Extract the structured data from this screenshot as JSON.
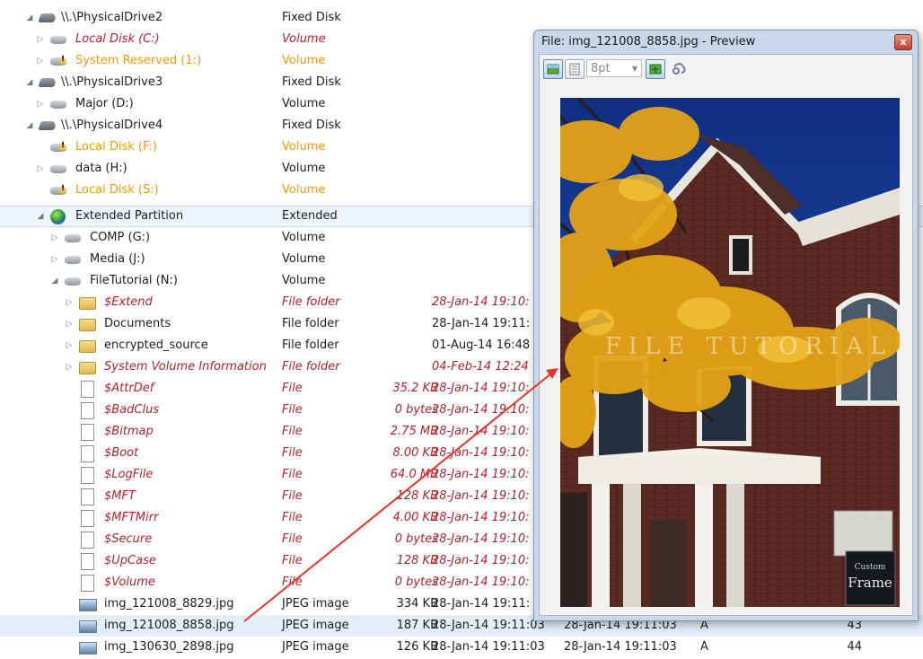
{
  "rows": [
    {
      "name": "\\\\.\\PhysicalDrive2",
      "type": "Fixed Disk"
    },
    {
      "name": "Local Disk (C:)",
      "type": "Volume"
    },
    {
      "name": "System Reserved (1:)",
      "type": "Volume"
    },
    {
      "name": "\\\\.\\PhysicalDrive3",
      "type": "Fixed Disk"
    },
    {
      "name": "Major (D:)",
      "type": "Volume"
    },
    {
      "name": "\\\\.\\PhysicalDrive4",
      "type": "Fixed Disk"
    },
    {
      "name": "Local Disk (F:)",
      "type": "Volume"
    },
    {
      "name": "data (H:)",
      "type": "Volume"
    },
    {
      "name": "Local Disk (S:)",
      "type": "Volume"
    },
    {
      "name": "Extended Partition",
      "type": "Extended"
    },
    {
      "name": "COMP (G:)",
      "type": "Volume"
    },
    {
      "name": "Media (J:)",
      "type": "Volume"
    },
    {
      "name": "FileTutorial (N:)",
      "type": "Volume"
    },
    {
      "name": "$Extend",
      "type": "File folder",
      "created": "28-Jan-14 19:10:"
    },
    {
      "name": "Documents",
      "type": "File folder",
      "created": "28-Jan-14 19:11:"
    },
    {
      "name": "encrypted_source",
      "type": "File folder",
      "created": "01-Aug-14 16:48"
    },
    {
      "name": "System Volume Information",
      "type": "File folder",
      "created": "04-Feb-14 12:24"
    },
    {
      "name": "$AttrDef",
      "type": "File",
      "size": "35.2 KB",
      "created": "28-Jan-14 19:10:"
    },
    {
      "name": "$BadClus",
      "type": "File",
      "size": "0 bytes",
      "created": "28-Jan-14 19:10:"
    },
    {
      "name": "$Bitmap",
      "type": "File",
      "size": "2.75 MB",
      "created": "28-Jan-14 19:10:"
    },
    {
      "name": "$Boot",
      "type": "File",
      "size": "8.00 KB",
      "created": "28-Jan-14 19:10:"
    },
    {
      "name": "$LogFile",
      "type": "File",
      "size": "64.0 MB",
      "created": "28-Jan-14 19:10:"
    },
    {
      "name": "$MFT",
      "type": "File",
      "size": "128 KB",
      "created": "28-Jan-14 19:10:"
    },
    {
      "name": "$MFTMirr",
      "type": "File",
      "size": "4.00 KB",
      "created": "28-Jan-14 19:10:"
    },
    {
      "name": "$Secure",
      "type": "File",
      "size": "0 bytes",
      "created": "28-Jan-14 19:10:"
    },
    {
      "name": "$UpCase",
      "type": "File",
      "size": "128 KB",
      "created": "28-Jan-14 19:10:"
    },
    {
      "name": "$Volume",
      "type": "File",
      "size": "0 bytes",
      "created": "28-Jan-14 19:10:"
    },
    {
      "name": "img_121008_8829.jpg",
      "type": "JPEG image",
      "size": "334 KB",
      "created": "28-Jan-14 19:11:"
    },
    {
      "name": "img_121008_8858.jpg",
      "type": "JPEG image",
      "size": "187 KB",
      "created": "28-Jan-14 19:11:03",
      "modified": "28-Jan-14 19:11:03",
      "attr": "A",
      "num": "43"
    },
    {
      "name": "img_130630_2898.jpg",
      "type": "JPEG image",
      "size": "126 KB",
      "created": "28-Jan-14 19:11:03",
      "modified": "28-Jan-14 19:11:03",
      "attr": "A",
      "num": "44"
    }
  ],
  "preview": {
    "title": "File: img_121008_8858.jpg - Preview",
    "close_label": "x",
    "font_size_value": "8pt",
    "photo_sign_text": "Frame",
    "photo_sign_sub": "Custom",
    "watermark": "FILE TUTORIAL",
    "colors": {
      "sky": "#1e3f8f",
      "brick": "#5a2a22",
      "leaves": "#e2a41c"
    }
  },
  "icons": {
    "close": "close-icon",
    "image_view": "image-view-icon",
    "text_view": "text-view-icon",
    "fit": "fit-to-window-icon",
    "wrap": "wrap-icon"
  }
}
